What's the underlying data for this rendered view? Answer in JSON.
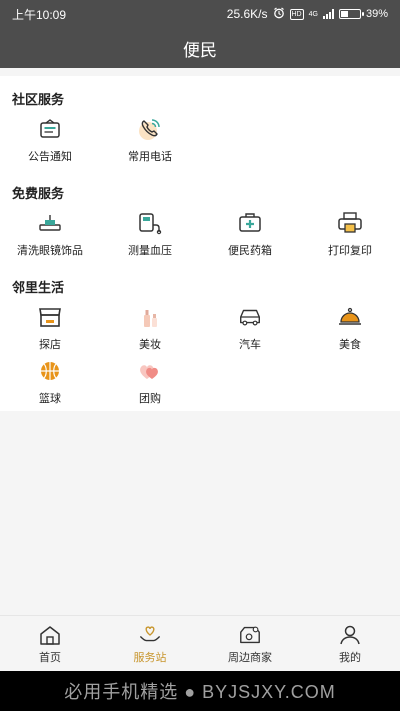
{
  "status": {
    "time": "上午10:09",
    "net_speed": "25.6K/s",
    "hd": "HD",
    "network": "4G",
    "battery": "39%",
    "battery_level": 0.39,
    "alarm_icon": "alarm-icon",
    "signal_icon": "signal-icon"
  },
  "header": {
    "title": "便民"
  },
  "sections": [
    {
      "title": "社区服务",
      "items": [
        {
          "label": "公告通知",
          "icon": "notice-icon"
        },
        {
          "label": "常用电话",
          "icon": "phone-icon"
        }
      ]
    },
    {
      "title": "免费服务",
      "items": [
        {
          "label": "清洗眼镜饰品",
          "icon": "glasses-cleaner-icon"
        },
        {
          "label": "测量血压",
          "icon": "blood-pressure-icon"
        },
        {
          "label": "便民药箱",
          "icon": "medicine-box-icon"
        },
        {
          "label": "打印复印",
          "icon": "printer-icon"
        }
      ]
    },
    {
      "title": "邻里生活",
      "items": [
        {
          "label": "探店",
          "icon": "shop-icon"
        },
        {
          "label": "美妆",
          "icon": "cosmetics-icon"
        },
        {
          "label": "汽车",
          "icon": "car-icon"
        },
        {
          "label": "美食",
          "icon": "food-cloche-icon"
        },
        {
          "label": "篮球",
          "icon": "basketball-icon"
        },
        {
          "label": "团购",
          "icon": "group-buy-icon"
        }
      ]
    }
  ],
  "tabs": [
    {
      "label": "首页",
      "icon": "home-icon"
    },
    {
      "label": "服务站",
      "icon": "service-heart-icon",
      "active": true
    },
    {
      "label": "周边商家",
      "icon": "nearby-store-icon"
    },
    {
      "label": "我的",
      "icon": "user-icon"
    }
  ],
  "watermark": "必用手机精选 ● BYJSJXY.COM",
  "colors": {
    "header": "#4d4d4d",
    "accent": "#c8962e",
    "teal": "#3aa89b",
    "orange": "#e8941a"
  }
}
